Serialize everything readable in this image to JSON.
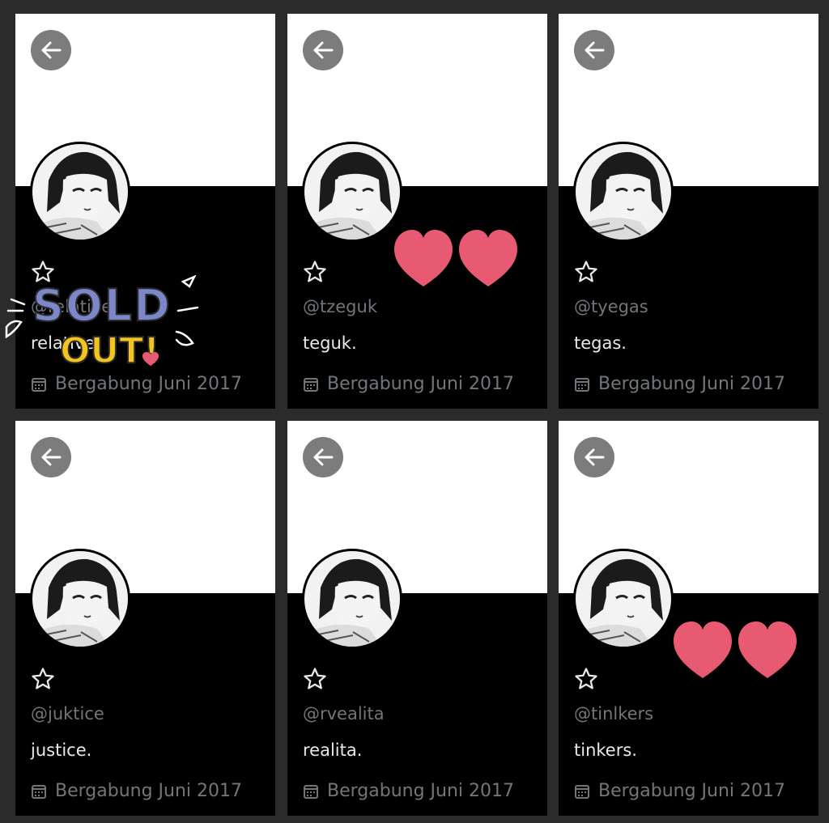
{
  "cards": [
    {
      "handle": "@relative",
      "name": "relative.",
      "joined": "Bergabung Juni 2017"
    },
    {
      "handle": "@tzeguk",
      "name": "teguk.",
      "joined": "Bergabung Juni 2017"
    },
    {
      "handle": "@tyegas",
      "name": "tegas.",
      "joined": "Bergabung Juni 2017"
    },
    {
      "handle": "@juktice",
      "name": "justice.",
      "joined": "Bergabung Juni 2017"
    },
    {
      "handle": "@rvealita",
      "name": "realita.",
      "joined": "Bergabung Juni 2017"
    },
    {
      "handle": "@tinlkers",
      "name": "tinkers.",
      "joined": "Bergabung Juni 2017"
    }
  ],
  "sticker": {
    "line1": "SOLD",
    "line2": "OUT!"
  },
  "colors": {
    "heart": "#e85a71",
    "sticker_blue": "#7b87c9",
    "sticker_yellow": "#f2c41c"
  },
  "icons": [
    "back-arrow-icon",
    "star-outline-icon",
    "calendar-icon",
    "heart-icon"
  ]
}
